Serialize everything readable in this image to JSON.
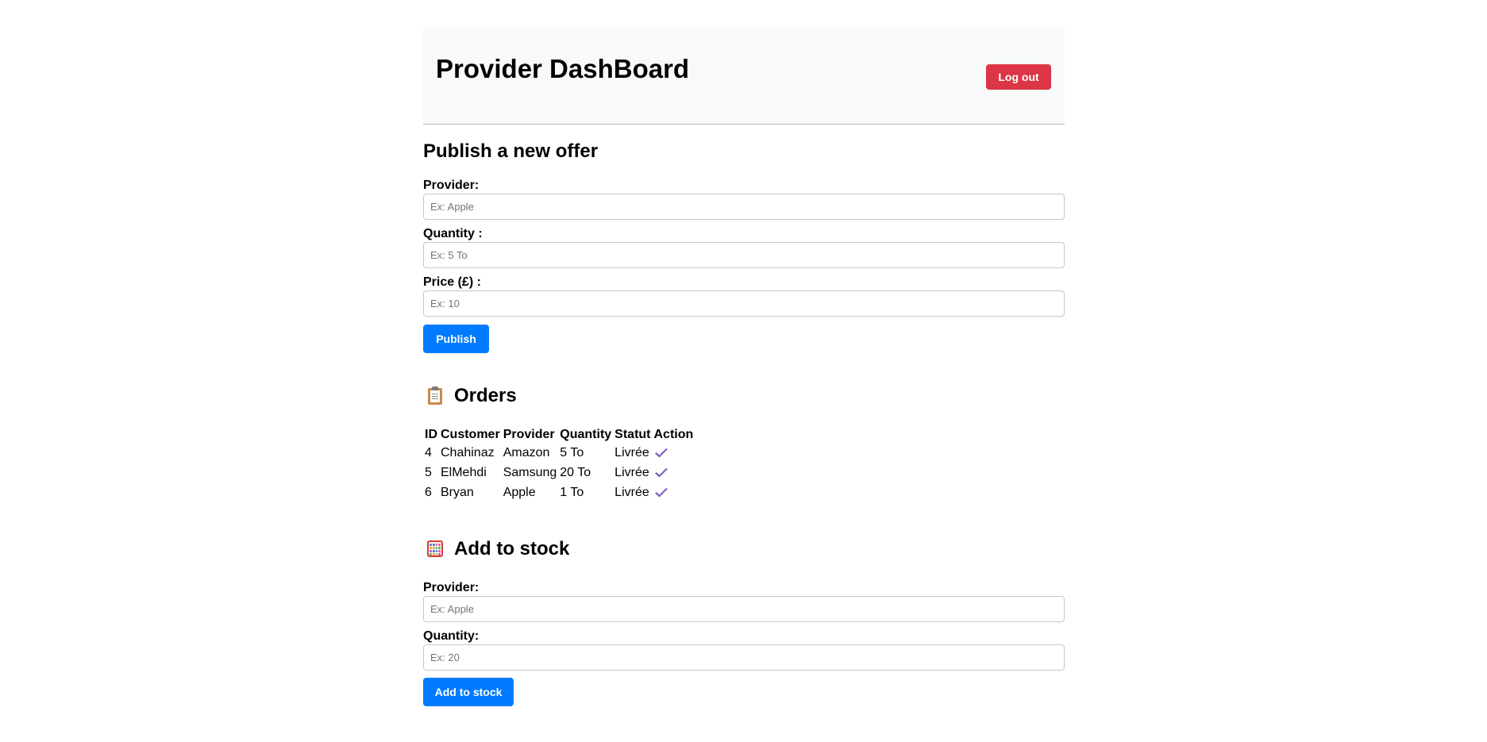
{
  "header": {
    "title": "Provider DashBoard",
    "logout_label": "Log out"
  },
  "offer_form": {
    "heading": "Publish a new offer",
    "provider_label": "Provider:",
    "provider_placeholder": "Ex: Apple",
    "quantity_label": "Quantity :",
    "quantity_placeholder": "Ex: 5 To",
    "price_label": "Price (£) :",
    "price_placeholder": "Ex: 10",
    "submit_label": "Publish"
  },
  "orders": {
    "heading": "Orders",
    "icon": "clipboard-icon",
    "columns": [
      "ID",
      "Customer",
      "Provider",
      "Quantity",
      "Statut",
      "Action"
    ],
    "rows": [
      {
        "id": "4",
        "customer": "Chahinaz",
        "provider": "Amazon",
        "quantity": "5 To",
        "statut": "Livrée"
      },
      {
        "id": "5",
        "customer": "ElMehdi",
        "provider": "Samsung",
        "quantity": "20 To",
        "statut": "Livrée"
      },
      {
        "id": "6",
        "customer": "Bryan",
        "provider": "Apple",
        "quantity": "1 To",
        "statut": "Livrée"
      }
    ],
    "action_icon": "checkmark-icon",
    "action_color": "#7b5fc4"
  },
  "stock_form": {
    "heading": "Add to stock",
    "icon": "abacus-icon",
    "provider_label": "Provider:",
    "provider_placeholder": "Ex: Apple",
    "quantity_label": "Quantity:",
    "quantity_placeholder": "Ex: 20",
    "submit_label": "Add to stock"
  },
  "colors": {
    "primary": "#007bff",
    "danger": "#dc3545",
    "header_bg": "#f8f9fa"
  }
}
